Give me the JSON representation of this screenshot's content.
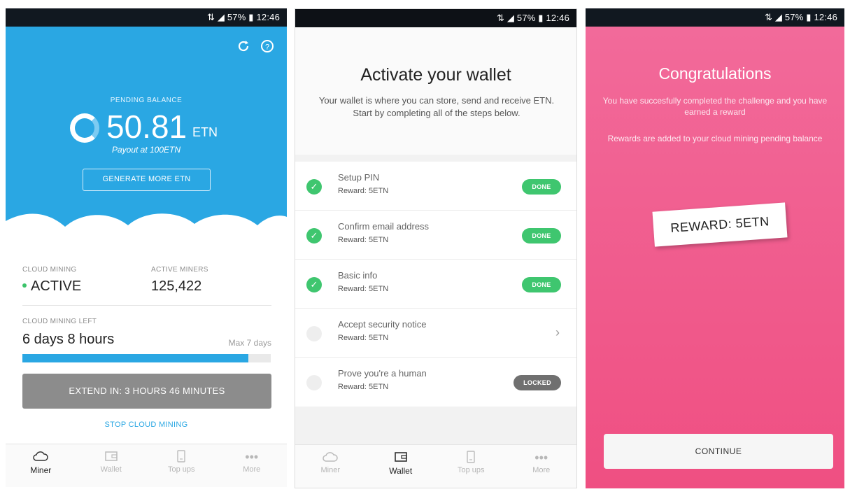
{
  "status_bar": {
    "text": "⇅ ◢ 57% ▮ 12:46"
  },
  "miner_screen": {
    "pending_label": "PENDING BALANCE",
    "balance_value": "50.81",
    "balance_unit": "ETN",
    "payout_text": "Payout at 100ETN",
    "generate_button": "GENERATE MORE ETN",
    "cloud_mining_label": "CLOUD MINING",
    "cloud_mining_status": "ACTIVE",
    "active_miners_label": "ACTIVE MINERS",
    "active_miners_value": "125,422",
    "mining_left_label": "CLOUD MINING LEFT",
    "mining_left_value": "6 days 8 hours",
    "max_days": "Max 7 days",
    "progress_fraction": 0.91,
    "extend_button": "EXTEND IN: 3 HOURS 46 MINUTES",
    "stop_link": "STOP CLOUD MINING",
    "accent_color": "#2aa7e3"
  },
  "wallet_screen": {
    "title": "Activate your wallet",
    "description": "Your wallet is where you can store, send and receive ETN. Start by completing all of the steps below.",
    "steps": [
      {
        "title": "Setup PIN",
        "reward": "Reward: 5ETN",
        "status": "DONE"
      },
      {
        "title": "Confirm email address",
        "reward": "Reward: 5ETN",
        "status": "DONE"
      },
      {
        "title": "Basic info",
        "reward": "Reward: 5ETN",
        "status": "DONE"
      },
      {
        "title": "Accept security notice",
        "reward": "Reward: 5ETN",
        "status": ""
      },
      {
        "title": "Prove you're a human",
        "reward": "Reward: 5ETN",
        "status": "LOCKED"
      }
    ]
  },
  "congrats_screen": {
    "title": "Congratulations",
    "message_1": "You have succesfully completed the challenge and you have earned a reward",
    "message_2": "Rewards are added to your cloud mining pending balance",
    "reward_card": "REWARD: 5ETN",
    "continue_button": "CONTINUE",
    "background_color": "#ef4f82"
  },
  "tabs": [
    {
      "label": "Miner",
      "icon": "cloud-icon"
    },
    {
      "label": "Wallet",
      "icon": "wallet-icon"
    },
    {
      "label": "Top ups",
      "icon": "phone-icon"
    },
    {
      "label": "More",
      "icon": "more-dots-icon"
    }
  ]
}
